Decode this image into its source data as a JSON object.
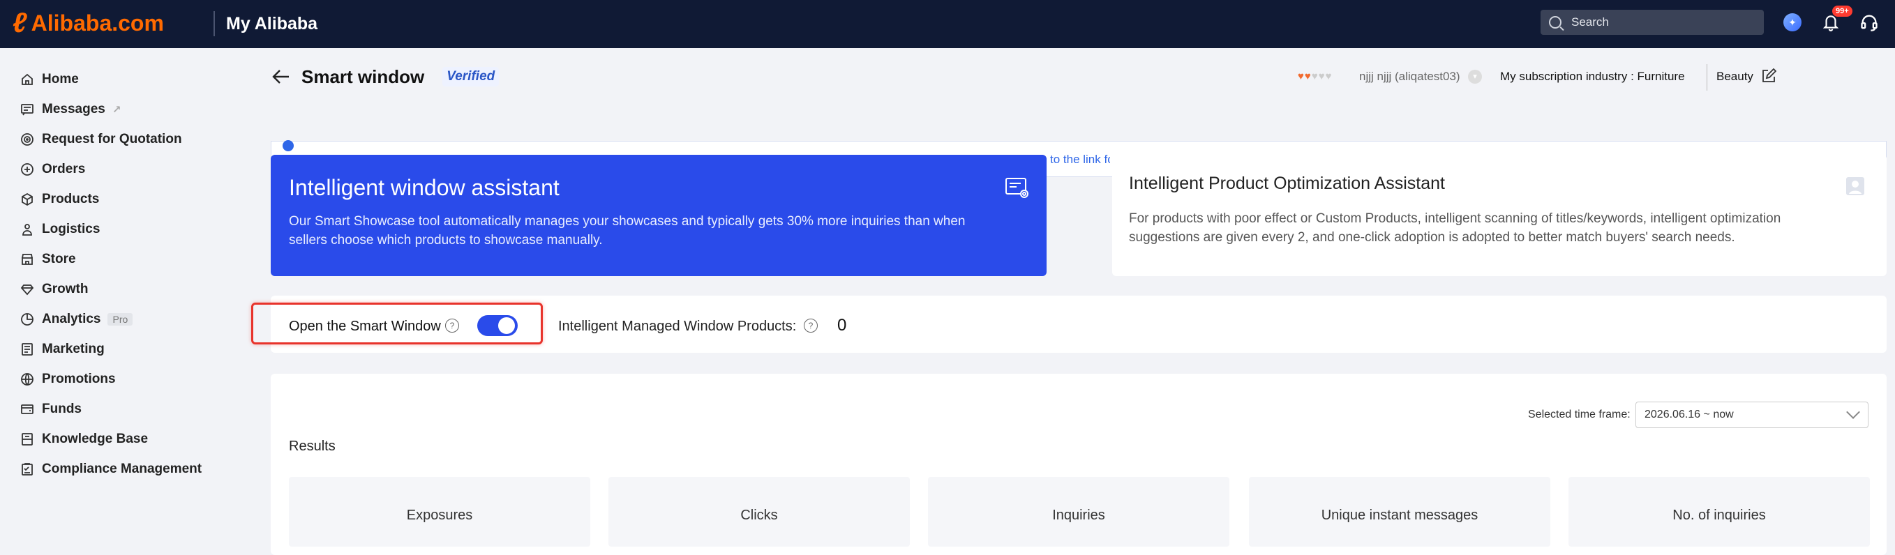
{
  "topbar": {
    "logo_text": "Alibaba.com",
    "product_name": "My Alibaba",
    "search_placeholder": "Search",
    "notification_badge": "99+",
    "brand_color": "#ff6a00",
    "bar_color": "#101a35"
  },
  "sidebar": {
    "items": [
      {
        "label": "Home",
        "icon": "home-icon"
      },
      {
        "label": "Messages",
        "icon": "message-icon",
        "external": true
      },
      {
        "label": "Request for Quotation",
        "icon": "target-icon"
      },
      {
        "label": "Orders",
        "icon": "orders-icon"
      },
      {
        "label": "Products",
        "icon": "box-icon"
      },
      {
        "label": "Logistics",
        "icon": "truck-icon"
      },
      {
        "label": "Store",
        "icon": "store-icon"
      },
      {
        "label": "Growth",
        "icon": "diamond-icon"
      },
      {
        "label": "Analytics",
        "icon": "chart-icon",
        "badge": "Pro"
      },
      {
        "label": "Marketing",
        "icon": "marketing-icon"
      },
      {
        "label": "Promotions",
        "icon": "globe-icon"
      },
      {
        "label": "Funds",
        "icon": "wallet-icon"
      },
      {
        "label": "Knowledge Base",
        "icon": "book-icon"
      },
      {
        "label": "Compliance Management",
        "icon": "clipboard-icon"
      }
    ]
  },
  "header": {
    "title": "Smart window",
    "verified": "Verified",
    "user_name": "njjj njjj (aliqatest03)",
    "subscription": "My subscription industry : Furniture",
    "industry2": "Beauty"
  },
  "notice": {
    "link_text": "to the link for"
  },
  "assistant": {
    "title": "Intelligent window assistant",
    "description": "Our Smart Showcase tool automatically manages your showcases and typically gets 30% more inquiries than when sellers choose which products to showcase manually.",
    "card_color": "#2a4bea"
  },
  "optimization": {
    "title": "Intelligent Product Optimization Assistant",
    "description": "For products with poor effect or Custom Products, intelligent scanning of titles/keywords, intelligent optimization suggestions are given every 2, and one-click adoption is adopted to better match buyers' search needs."
  },
  "smart_switch": {
    "label": "Open the Smart Window",
    "enabled": true,
    "managed_label": "Intelligent Managed Window Products:",
    "managed_count": "0",
    "highlight_color": "#e8332b"
  },
  "results": {
    "time_label": "Selected time frame:",
    "time_value": "2026.06.16 ~ now",
    "title": "Results",
    "metrics": [
      "Exposures",
      "Clicks",
      "Inquiries",
      "Unique instant messages",
      "No. of inquiries"
    ]
  }
}
